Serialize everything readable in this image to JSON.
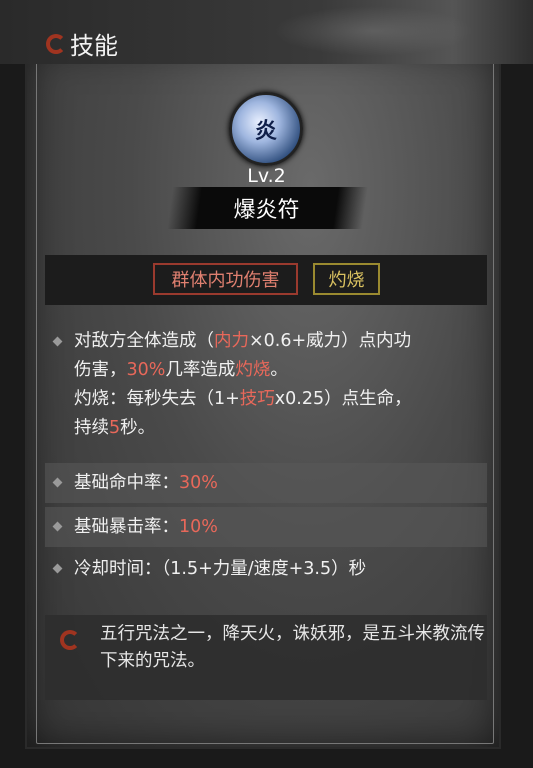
{
  "header": {
    "title": "技能"
  },
  "skill": {
    "icon_glyph": "炎",
    "level": "Lv.2",
    "name": "爆炎符",
    "tags": [
      "群体内功伤害",
      "灼烧"
    ]
  },
  "description": {
    "line1_a": "对敌方全体造成（",
    "line1_b": "内力",
    "line1_c": "×0.6+威力）点内功",
    "line2_a": "伤害，",
    "line2_b": "30%",
    "line2_c": "几率造成",
    "line2_d": "灼烧",
    "line2_e": "。",
    "line3_a": "灼烧：每秒失去（1+",
    "line3_b": "技巧",
    "line3_c": "x0.25）点生命，",
    "line4_a": "持续",
    "line4_b": "5",
    "line4_c": "秒。"
  },
  "stats": [
    {
      "label": "基础命中率：",
      "value": "30%"
    },
    {
      "label": "基础暴击率：",
      "value": "10%"
    },
    {
      "label": "冷却时间：（1.5+力量/速度+3.5）秒",
      "value": ""
    }
  ],
  "lore": "五行咒法之一，降天火，诛妖邪，是五斗米教流传下来的咒法。",
  "colors": {
    "accent_red": "#e8685a",
    "tag_yellow": "#d8c060",
    "panel": "#4a4a4a"
  }
}
